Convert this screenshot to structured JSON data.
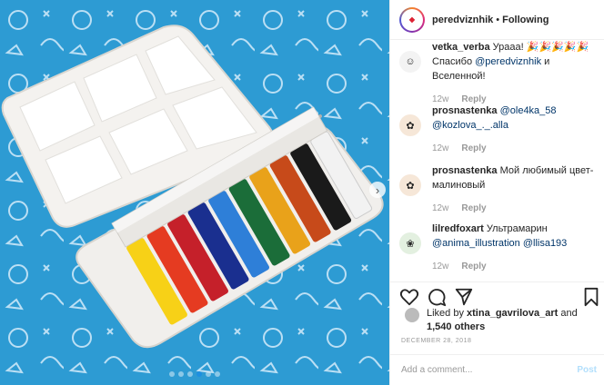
{
  "header": {
    "username": "peredviznhik",
    "separator": "•",
    "follow_label": "Following"
  },
  "comments": [
    {
      "user": "vetka_verba",
      "parts": [
        {
          "t": "text",
          "v": "Урааа! "
        },
        {
          "t": "text",
          "v": "🎉🎉🎉🎉🎉"
        },
        {
          "t": "text",
          "v": " Спасибо "
        },
        {
          "t": "mention",
          "v": "@peredviznhik"
        },
        {
          "t": "text",
          "v": " и Вселенной!"
        }
      ],
      "age": "12w",
      "reply": "Reply"
    },
    {
      "user": "prosnastenka",
      "parts": [
        {
          "t": "mention",
          "v": "@ole4ka_58"
        },
        {
          "t": "text",
          "v": " "
        },
        {
          "t": "mention",
          "v": "@kozlova_._.alla"
        }
      ],
      "age": "12w",
      "reply": "Reply"
    },
    {
      "user": "prosnastenka",
      "parts": [
        {
          "t": "text",
          "v": "Мой любимый цвет- малиновый"
        }
      ],
      "age": "12w",
      "reply": "Reply"
    },
    {
      "user": "lilredfoxart",
      "parts": [
        {
          "t": "text",
          "v": "Ультрамарин "
        },
        {
          "t": "mention",
          "v": "@anima_illustration"
        },
        {
          "t": "text",
          "v": " "
        },
        {
          "t": "mention",
          "v": "@llisa193"
        }
      ],
      "age": "12w",
      "reply": "Reply"
    }
  ],
  "likes": {
    "prefix": "Liked by ",
    "user": "xtina_gavrilova_art",
    "and": " and ",
    "count": "1,540 others"
  },
  "date": "DECEMBER 28, 2018",
  "add_comment": {
    "placeholder": "Add a comment...",
    "post_label": "Post"
  },
  "carousel": {
    "total_dots": 6,
    "active_index": 3
  },
  "colors": {
    "photo_bg": "#2d9bd3",
    "mention": "#003569",
    "post_disabled": "#b2dffc",
    "dot_active": "#1d8fe0"
  },
  "icons": [
    "heart-icon",
    "comment-icon",
    "share-icon",
    "bookmark-icon",
    "chevron-right-icon"
  ]
}
